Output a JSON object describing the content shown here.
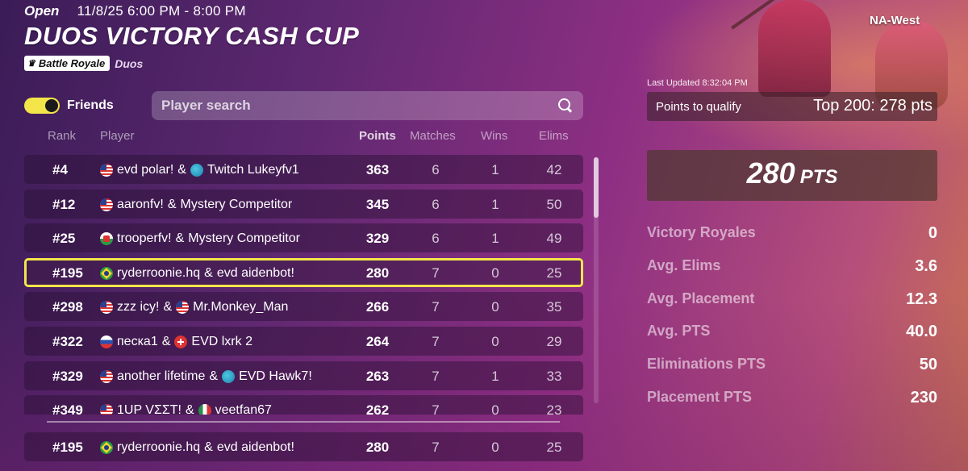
{
  "header": {
    "status": "Open",
    "time": "11/8/25 6:00 PM - 8:00 PM",
    "title": "DUOS VICTORY CASH CUP",
    "mode": "Battle Royale",
    "mode_sub": "Duos"
  },
  "friends_toggle": {
    "label": "Friends",
    "state": "on"
  },
  "search": {
    "placeholder": "Player search"
  },
  "table": {
    "columns": [
      "Rank",
      "Player",
      "Points",
      "Matches",
      "Wins",
      "Elims"
    ],
    "rows": [
      {
        "rank": "#4",
        "p1_flag": "us",
        "p1": "evd polar!",
        "p2_flag": "globe",
        "p2": "Twitch Lukeyfv1",
        "points": "363",
        "matches": "6",
        "wins": "1",
        "elims": "42"
      },
      {
        "rank": "#12",
        "p1_flag": "us",
        "p1": "aaronfv!",
        "p2_flag": "",
        "p2": "Mystery Competitor",
        "points": "345",
        "matches": "6",
        "wins": "1",
        "elims": "50"
      },
      {
        "rank": "#25",
        "p1_flag": "wales",
        "p1": "trooperfv!",
        "p2_flag": "",
        "p2": "Mystery Competitor",
        "points": "329",
        "matches": "6",
        "wins": "1",
        "elims": "49"
      },
      {
        "rank": "#195",
        "p1_flag": "br",
        "p1": "ryderroonie.hq",
        "p2_flag": "",
        "p2": "evd aidenbot!",
        "points": "280",
        "matches": "7",
        "wins": "0",
        "elims": "25"
      },
      {
        "rank": "#298",
        "p1_flag": "us",
        "p1": "zzz icy!",
        "p2_flag": "us",
        "p2": "Mr.Monkey_Man",
        "points": "266",
        "matches": "7",
        "wins": "0",
        "elims": "35"
      },
      {
        "rank": "#322",
        "p1_flag": "ru",
        "p1": "песка1",
        "p2_flag": "ch",
        "p2": "EVD lxrk 2",
        "points": "264",
        "matches": "7",
        "wins": "0",
        "elims": "29"
      },
      {
        "rank": "#329",
        "p1_flag": "us",
        "p1": "another lifetime",
        "p2_flag": "globe",
        "p2": "EVD Hawk7!",
        "points": "263",
        "matches": "7",
        "wins": "1",
        "elims": "33"
      },
      {
        "rank": "#349",
        "p1_flag": "us",
        "p1": "1UP VΣΣT!",
        "p2_flag": "mx",
        "p2": "veetfan67",
        "points": "262",
        "matches": "7",
        "wins": "0",
        "elims": "23"
      }
    ],
    "highlighted_rank": "#195"
  },
  "pinned_row": {
    "rank": "#195",
    "p1_flag": "br",
    "p1": "ryderroonie.hq",
    "p2": "evd aidenbot!",
    "points": "280",
    "matches": "7",
    "wins": "0",
    "elims": "25"
  },
  "panel": {
    "region": "NA-West",
    "last_updated": "Last Updated 8:32:04 PM",
    "qualify_label": "Points to qualify",
    "qualify_value": "Top 200: 278 pts",
    "points_value": "280",
    "points_unit": "PTS",
    "stats": [
      {
        "label": "Victory Royales",
        "value": "0"
      },
      {
        "label": "Avg. Elims",
        "value": "3.6"
      },
      {
        "label": "Avg. Placement",
        "value": "12.3"
      },
      {
        "label": "Avg. PTS",
        "value": "40.0"
      },
      {
        "label": "Eliminations PTS",
        "value": "50"
      },
      {
        "label": "Placement PTS",
        "value": "230"
      }
    ]
  },
  "colors": {
    "accent_yellow": "#f3e54a",
    "row_bg": "#2a0f32"
  }
}
